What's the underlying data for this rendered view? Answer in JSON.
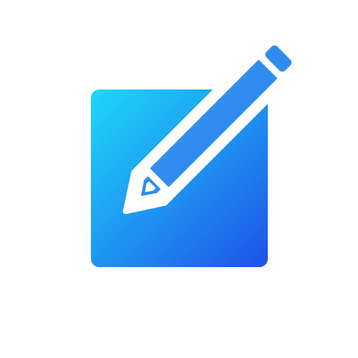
{
  "icon": {
    "name": "compose-icon",
    "colors": {
      "gradient_start": "#1ED8FA",
      "gradient_end": "#1F52E8",
      "pencil": "#2E8DEE",
      "outline": "#FFFFFF",
      "background": "#FFFFFF"
    }
  }
}
